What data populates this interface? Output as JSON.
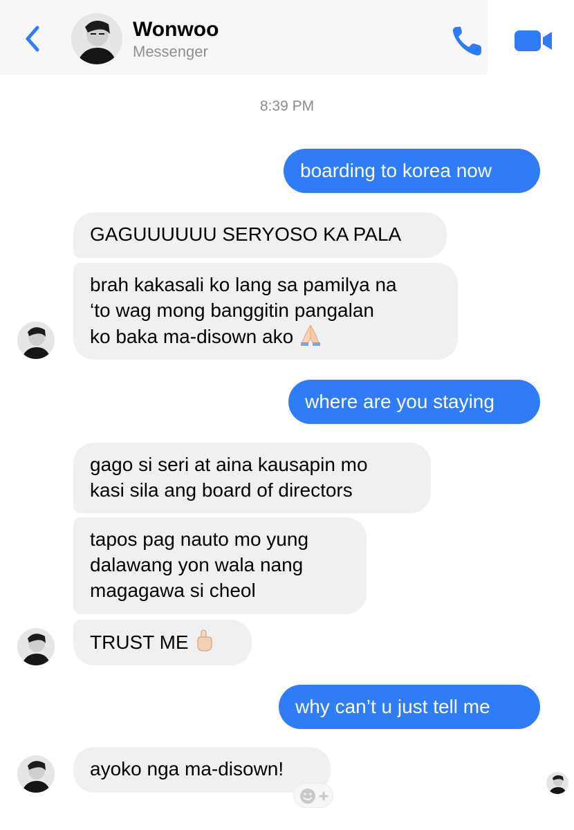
{
  "header": {
    "contact_name": "Wonwoo",
    "subtitle": "Messenger",
    "icons": [
      "back-chevron-icon",
      "phone-icon",
      "video-camera-icon"
    ],
    "accent_color": "#2f7cf6"
  },
  "conversation": {
    "timestamp": "8:39 PM",
    "messages": [
      {
        "sender": "me",
        "text": "boarding to korea now"
      },
      {
        "sender": "Wonwoo",
        "text": "GAGUUUUUU SERYOSO KA PALA"
      },
      {
        "sender": "Wonwoo",
        "lines": [
          "brah kakasali ko lang sa pamilya na",
          "‘to wag mong banggitin pangalan",
          "ko baka ma-disown ako"
        ],
        "emoji": "folded-hands"
      },
      {
        "sender": "me",
        "text": "where are you staying"
      },
      {
        "sender": "Wonwoo",
        "lines": [
          "gago si seri at aina kausapin mo",
          "kasi sila ang board of directors"
        ]
      },
      {
        "sender": "Wonwoo",
        "lines": [
          "tapos pag nauto mo yung",
          "dalawang yon wala nang",
          "magagawa si cheol"
        ]
      },
      {
        "sender": "Wonwoo",
        "text": "TRUST ME",
        "emoji": "index-pointing-up"
      },
      {
        "sender": "me",
        "text": "why can’t u just tell me"
      },
      {
        "sender": "Wonwoo",
        "text": "ayoko nga ma-disown!"
      }
    ]
  },
  "colors": {
    "outgoing_bubble": "#2f7cf6",
    "incoming_bubble": "#f0f0f0",
    "secondary_text": "#8e8e93"
  }
}
